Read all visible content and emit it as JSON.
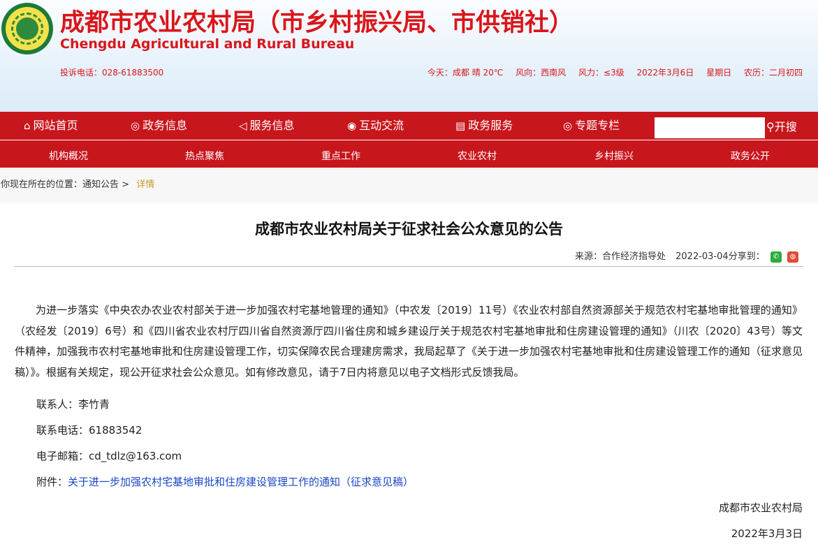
{
  "header": {
    "title": "成都市农业农村局（市乡村振兴局、市供销社）",
    "subtitle": "Chengdu Agricultural and Rural Bureau",
    "hotline": "投诉电话：028-61883500",
    "weather": {
      "today": "今天：成都 晴 20℃",
      "wind_dir": "风向：西南风",
      "wind_force": "风力：≤3级",
      "date": "2022年3月6日",
      "weekday": "星期日",
      "lunar": "农历：二月初四"
    }
  },
  "nav_primary": [
    {
      "icon": "home-icon",
      "label": "网站首页"
    },
    {
      "icon": "chat-icon",
      "label": "政务信息"
    },
    {
      "icon": "megaphone-icon",
      "label": "服务信息"
    },
    {
      "icon": "globe-icon",
      "label": "互动交流"
    },
    {
      "icon": "document-icon",
      "label": "政务服务"
    },
    {
      "icon": "chat-bubble-icon",
      "label": "专题专栏"
    }
  ],
  "search": {
    "value": "",
    "button_label": "开搜"
  },
  "nav_secondary": [
    "机构概况",
    "热点聚焦",
    "重点工作",
    "农业农村",
    "乡村振兴",
    "政务公开"
  ],
  "breadcrumb": {
    "prefix": "你现在所在的位置：",
    "parent": "通知公告",
    "separator": ">",
    "current": "详情"
  },
  "article": {
    "title": "成都市农业农村局关于征求社会公众意见的公告",
    "source": "来源：合作经济指导处",
    "date": "2022-03-04",
    "share_label": "分享到：",
    "body": "为进一步落实《中央农办农业农村部关于进一步加强农村宅基地管理的通知》（中农发〔2019〕11号）《农业农村部自然资源部关于规范农村宅基地审批管理的通知》（农经发〔2019〕6号）和《四川省农业农村厅四川省自然资源厅四川省住房和城乡建设厅关于规范农村宅基地审批和住房建设管理的通知》（川农〔2020〕43号）等文件精神，加强我市农村宅基地审批和住房建设管理工作，切实保障农民合理建房需求，我局起草了《关于进一步加强农村宅基地审批和住房建设管理工作的通知（征求意见稿）》。根据有关规定，现公开征求社会公众意见。如有修改意见，请于7日内将意见以电子文档形式反馈我局。",
    "contact_label": "联系人：",
    "contact": "李竹青",
    "phone_label": "联系电话：",
    "phone": "61883542",
    "email_label": "电子邮箱：",
    "email": "cd_tdlz@163.com",
    "attachment_label": "附件：",
    "attachment": "关于进一步加强农村宅基地审批和住房建设管理工作的通知（征求意见稿）",
    "signature": "成都市农业农村局",
    "sign_date": "2022年3月3日"
  },
  "colors": {
    "brand_red": "#c8161d",
    "title_red": "#d9161b",
    "link_blue": "#1a47c8",
    "crumb_gold": "#c79b2a"
  }
}
